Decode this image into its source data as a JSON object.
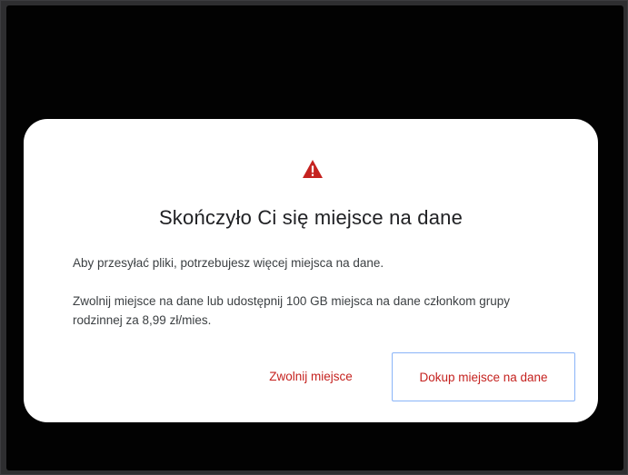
{
  "dialog": {
    "icon": "warning-triangle-icon",
    "title": "Skończyło Ci się miejsce na dane",
    "message_1": "Aby przesyłać pliki, potrzebujesz więcej miejsca na dane.",
    "message_2": "Zwolnij miejsce na dane lub udostępnij 100 GB miejsca na dane członkom grupy rodzinnej za 8,99 zł/mies.",
    "buttons": {
      "free_space": "Zwolnij miejsce",
      "buy_storage": "Dokup miejsce na dane"
    }
  },
  "colors": {
    "accent_red": "#c5221f",
    "focus_ring": "#8ab4f8",
    "backdrop": "#020202",
    "dialog_bg": "#ffffff"
  }
}
